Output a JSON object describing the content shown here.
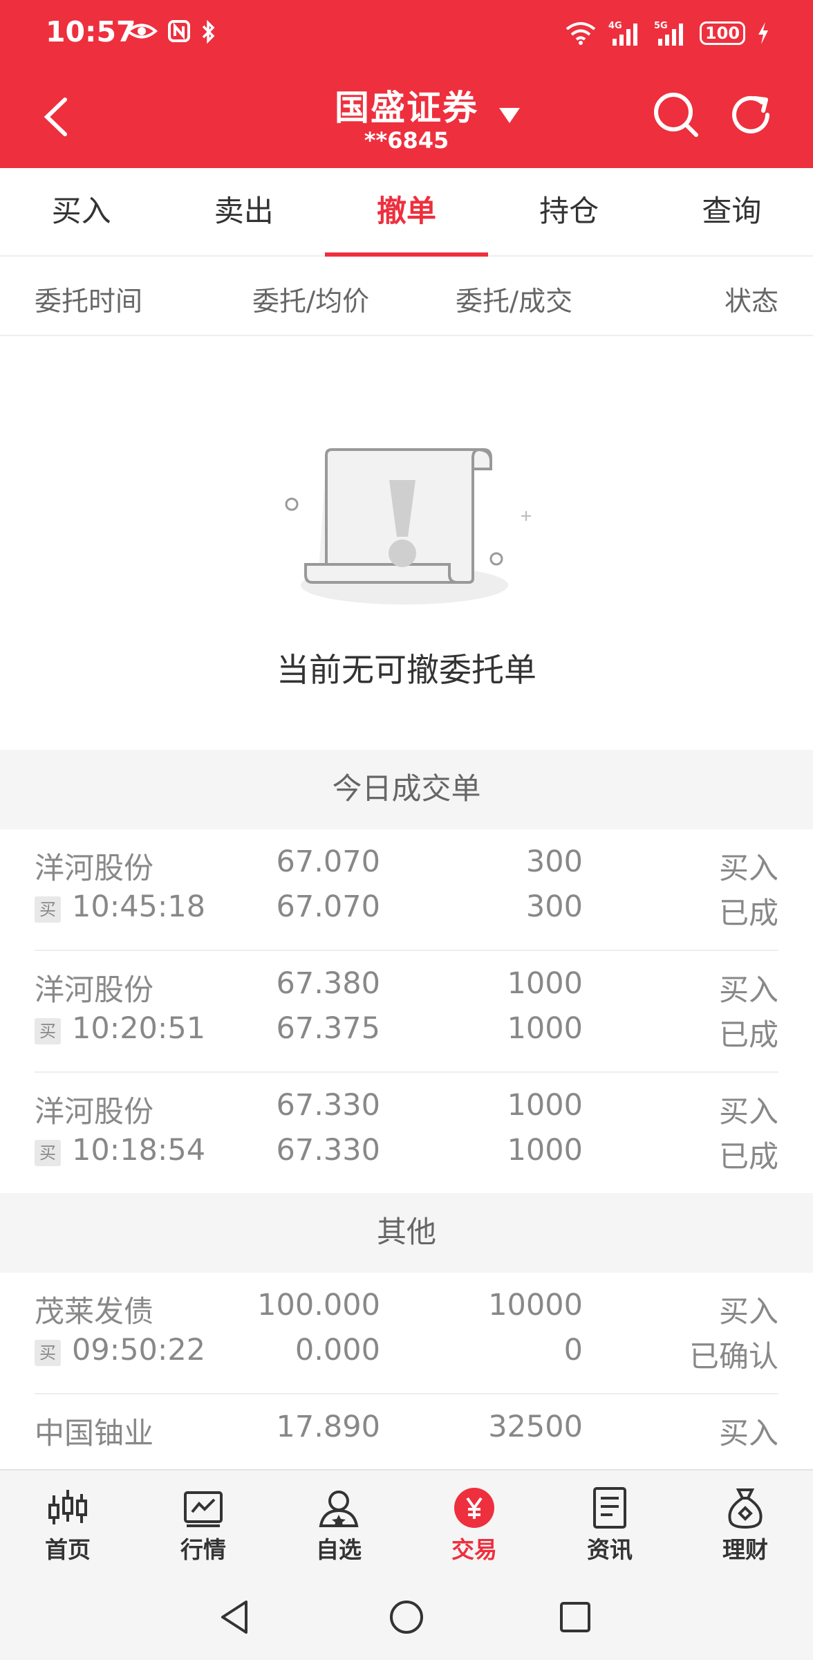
{
  "status_bar": {
    "time": "10:57",
    "battery": "100",
    "icons": [
      "eye-icon",
      "nfc-icon",
      "bluetooth-icon",
      "wifi-icon",
      "signal-4g-icon",
      "signal-5g-icon",
      "battery-icon",
      "charging-icon"
    ]
  },
  "header": {
    "title": "国盛证券",
    "account": "**6845",
    "accent_color": "#ee2f3d"
  },
  "tabs": [
    {
      "label": "买入",
      "active": false
    },
    {
      "label": "卖出",
      "active": false
    },
    {
      "label": "撤单",
      "active": true
    },
    {
      "label": "持仓",
      "active": false
    },
    {
      "label": "查询",
      "active": false
    }
  ],
  "columns": {
    "time": "委托时间",
    "price": "委托/均价",
    "qty": "委托/成交",
    "status": "状态"
  },
  "empty_state": {
    "message": "当前无可撤委托单",
    "icon": "empty-scroll-exclamation-icon"
  },
  "today_section": {
    "title": "今日成交单",
    "rows": [
      {
        "name": "洋河股份",
        "tag": "买",
        "time": "10:45:18",
        "price": "67.070",
        "avg": "67.070",
        "qty": "300",
        "filled": "300",
        "side": "买入",
        "status": "已成"
      },
      {
        "name": "洋河股份",
        "tag": "买",
        "time": "10:20:51",
        "price": "67.380",
        "avg": "67.375",
        "qty": "1000",
        "filled": "1000",
        "side": "买入",
        "status": "已成"
      },
      {
        "name": "洋河股份",
        "tag": "买",
        "time": "10:18:54",
        "price": "67.330",
        "avg": "67.330",
        "qty": "1000",
        "filled": "1000",
        "side": "买入",
        "status": "已成"
      }
    ]
  },
  "other_section": {
    "title": "其他",
    "rows": [
      {
        "name": "茂莱发债",
        "tag": "买",
        "time": "09:50:22",
        "price": "100.000",
        "avg": "0.000",
        "qty": "10000",
        "filled": "0",
        "side": "买入",
        "status": "已确认"
      },
      {
        "name": "中国铀业",
        "tag": "",
        "time": "",
        "price": "17.890",
        "avg": "",
        "qty": "32500",
        "filled": "",
        "side": "买入",
        "status": ""
      }
    ]
  },
  "bottom_nav": [
    {
      "label": "首页",
      "icon": "candlestick-icon",
      "active": false
    },
    {
      "label": "行情",
      "icon": "chart-line-icon",
      "active": false
    },
    {
      "label": "自选",
      "icon": "user-star-icon",
      "active": false
    },
    {
      "label": "交易",
      "icon": "yuan-icon",
      "active": true
    },
    {
      "label": "资讯",
      "icon": "document-icon",
      "active": false
    },
    {
      "label": "理财",
      "icon": "money-bag-icon",
      "active": false
    }
  ]
}
